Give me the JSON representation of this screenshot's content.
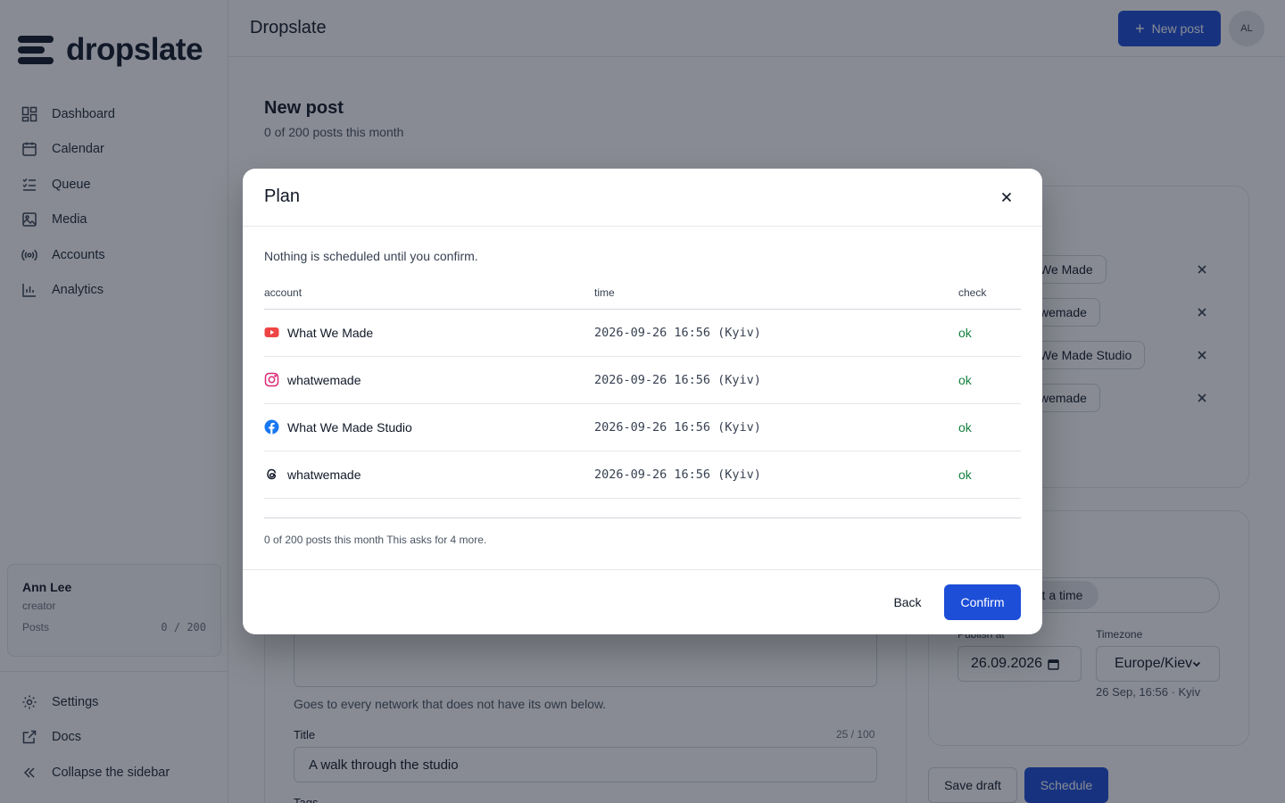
{
  "brand": {
    "name": "dropslate"
  },
  "topbar": {
    "title": "Dropslate",
    "new_post": "New post",
    "avatar_initials": "AL"
  },
  "sidebar": {
    "items": [
      {
        "label": "Dashboard",
        "icon": "dashboard-icon"
      },
      {
        "label": "Calendar",
        "icon": "calendar-icon"
      },
      {
        "label": "Queue",
        "icon": "queue-icon"
      },
      {
        "label": "Media",
        "icon": "media-icon"
      },
      {
        "label": "Accounts",
        "icon": "broadcast-icon"
      },
      {
        "label": "Analytics",
        "icon": "analytics-icon"
      }
    ],
    "user": {
      "name": "Ann Lee",
      "role": "creator",
      "posts_label": "Posts",
      "posts_value": "0 / 200"
    },
    "bottom_items": [
      {
        "label": "Settings",
        "icon": "gear-icon"
      },
      {
        "label": "Docs",
        "icon": "external-link-icon"
      },
      {
        "label": "Collapse the sidebar",
        "icon": "chevrons-left-icon"
      }
    ]
  },
  "page": {
    "title": "New post",
    "subtitle": "0 of 200 posts this month",
    "helper": "Goes to every network that does not have its own below.",
    "title_label": "Title",
    "title_count": "25 / 100",
    "title_value": "A walk through the studio",
    "tags_label": "Tags",
    "chips": [
      "We Made",
      "wemade",
      "We Made Studio",
      "wemade"
    ],
    "schedule_option": "t a time",
    "publish_label": "Publish at",
    "timezone_label": "Timezone",
    "publish_value": "26.09.2026",
    "timezone_value": "Europe/Kiev",
    "time_hint": "26 Sep, 16:56 · Kyiv",
    "save_draft": "Save draft",
    "schedule": "Schedule"
  },
  "modal": {
    "title": "Plan",
    "note": "Nothing is scheduled until you confirm.",
    "columns": {
      "account": "account",
      "time": "time",
      "check": "check"
    },
    "rows": [
      {
        "network": "youtube",
        "account": "What We Made",
        "time": "2026-09-26 16:56 (Kyiv)",
        "check": "ok"
      },
      {
        "network": "instagram",
        "account": "whatwemade",
        "time": "2026-09-26 16:56 (Kyiv)",
        "check": "ok"
      },
      {
        "network": "facebook",
        "account": "What We Made Studio",
        "time": "2026-09-26 16:56 (Kyiv)",
        "check": "ok"
      },
      {
        "network": "threads",
        "account": "whatwemade",
        "time": "2026-09-26 16:56 (Kyiv)",
        "check": "ok"
      }
    ],
    "footnote": "0 of 200 posts this month This asks for 4 more.",
    "back": "Back",
    "confirm": "Confirm"
  },
  "colors": {
    "accent": "#1d4ed8",
    "ok": "#15803d",
    "youtube": "#ef4444",
    "instagram": "#db2777",
    "facebook": "#1877f2"
  }
}
